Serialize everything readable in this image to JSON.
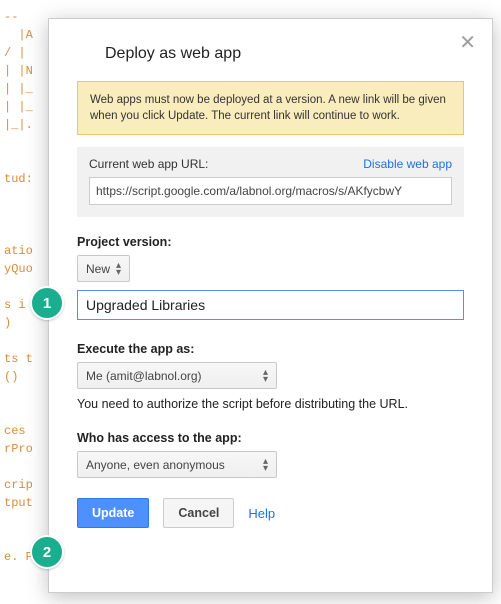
{
  "bg_code": "--\n  |A\n/ |\n| |N\n| |_\n| |_\n|_|.\n\n\ntud:\n\n\n\natio\nyQuo\n\ns i\n)\n\nts t\n()\n\n\nces\nrPro\n\ncrip\ntput\n\n\ne. Please do not copy or redistribute.",
  "dialog": {
    "title": "Deploy as web app",
    "notice": "Web apps must now be deployed at a version. A new link will be given when you click Update. The current link will continue to work.",
    "url_section": {
      "label": "Current web app URL:",
      "disable_link": "Disable web app",
      "url": "https://script.google.com/a/labnol.org/macros/s/AKfycbwY"
    },
    "version": {
      "label": "Project version:",
      "selected": "New",
      "description": "Upgraded Libraries"
    },
    "execute_as": {
      "label": "Execute the app as:",
      "selected": "Me (amit@labnol.org)",
      "note": "You need to authorize the script before distributing the URL."
    },
    "access": {
      "label": "Who has access to the app:",
      "selected": "Anyone, even anonymous"
    },
    "buttons": {
      "update": "Update",
      "cancel": "Cancel",
      "help": "Help"
    }
  },
  "badges": {
    "one": "1",
    "two": "2"
  }
}
